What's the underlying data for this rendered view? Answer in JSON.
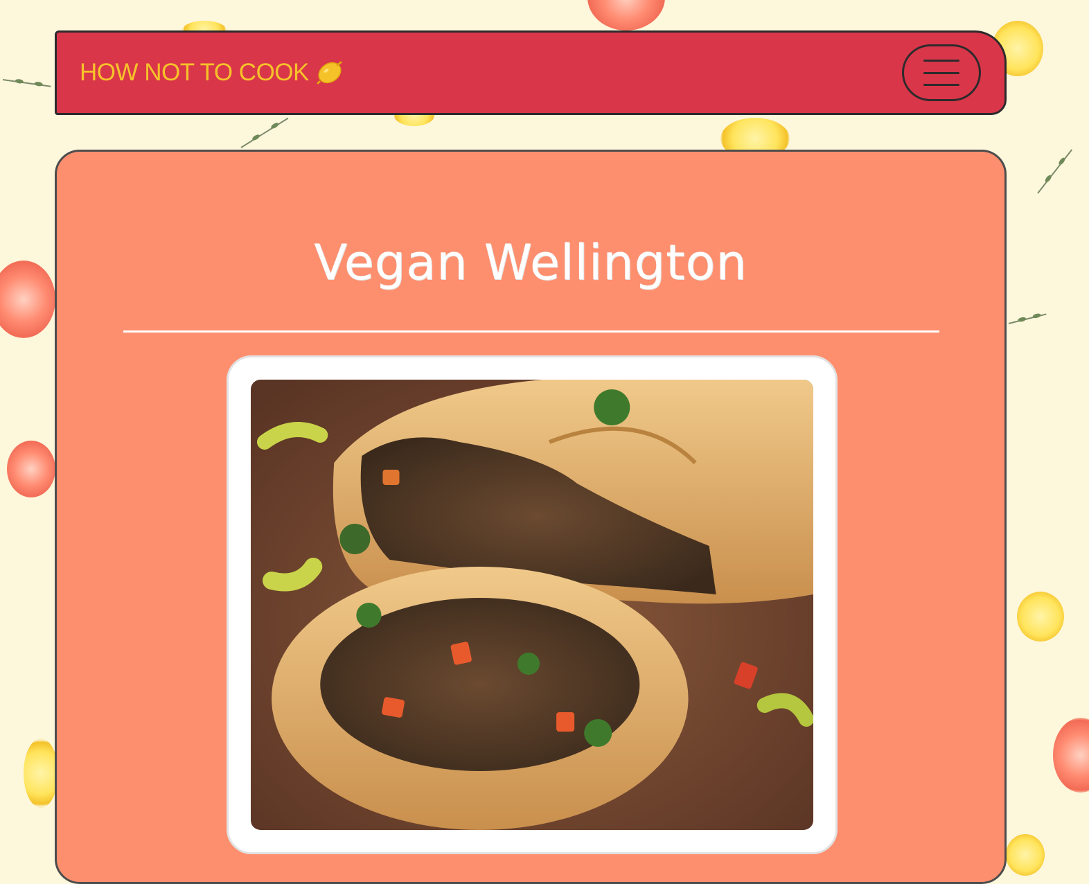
{
  "navbar": {
    "brand": "HOW NOT TO COOK",
    "brand_icon": "lemon-icon",
    "menu_icon": "hamburger-icon"
  },
  "main": {
    "title": "Vegan Wellington",
    "photo_subject": "wellington-photo"
  },
  "colors": {
    "navbar": "#d93649",
    "brand_text": "#f6c22a",
    "card": "#fe8f6e",
    "background": "#fdf7dc",
    "title_text": "#ffffff"
  }
}
